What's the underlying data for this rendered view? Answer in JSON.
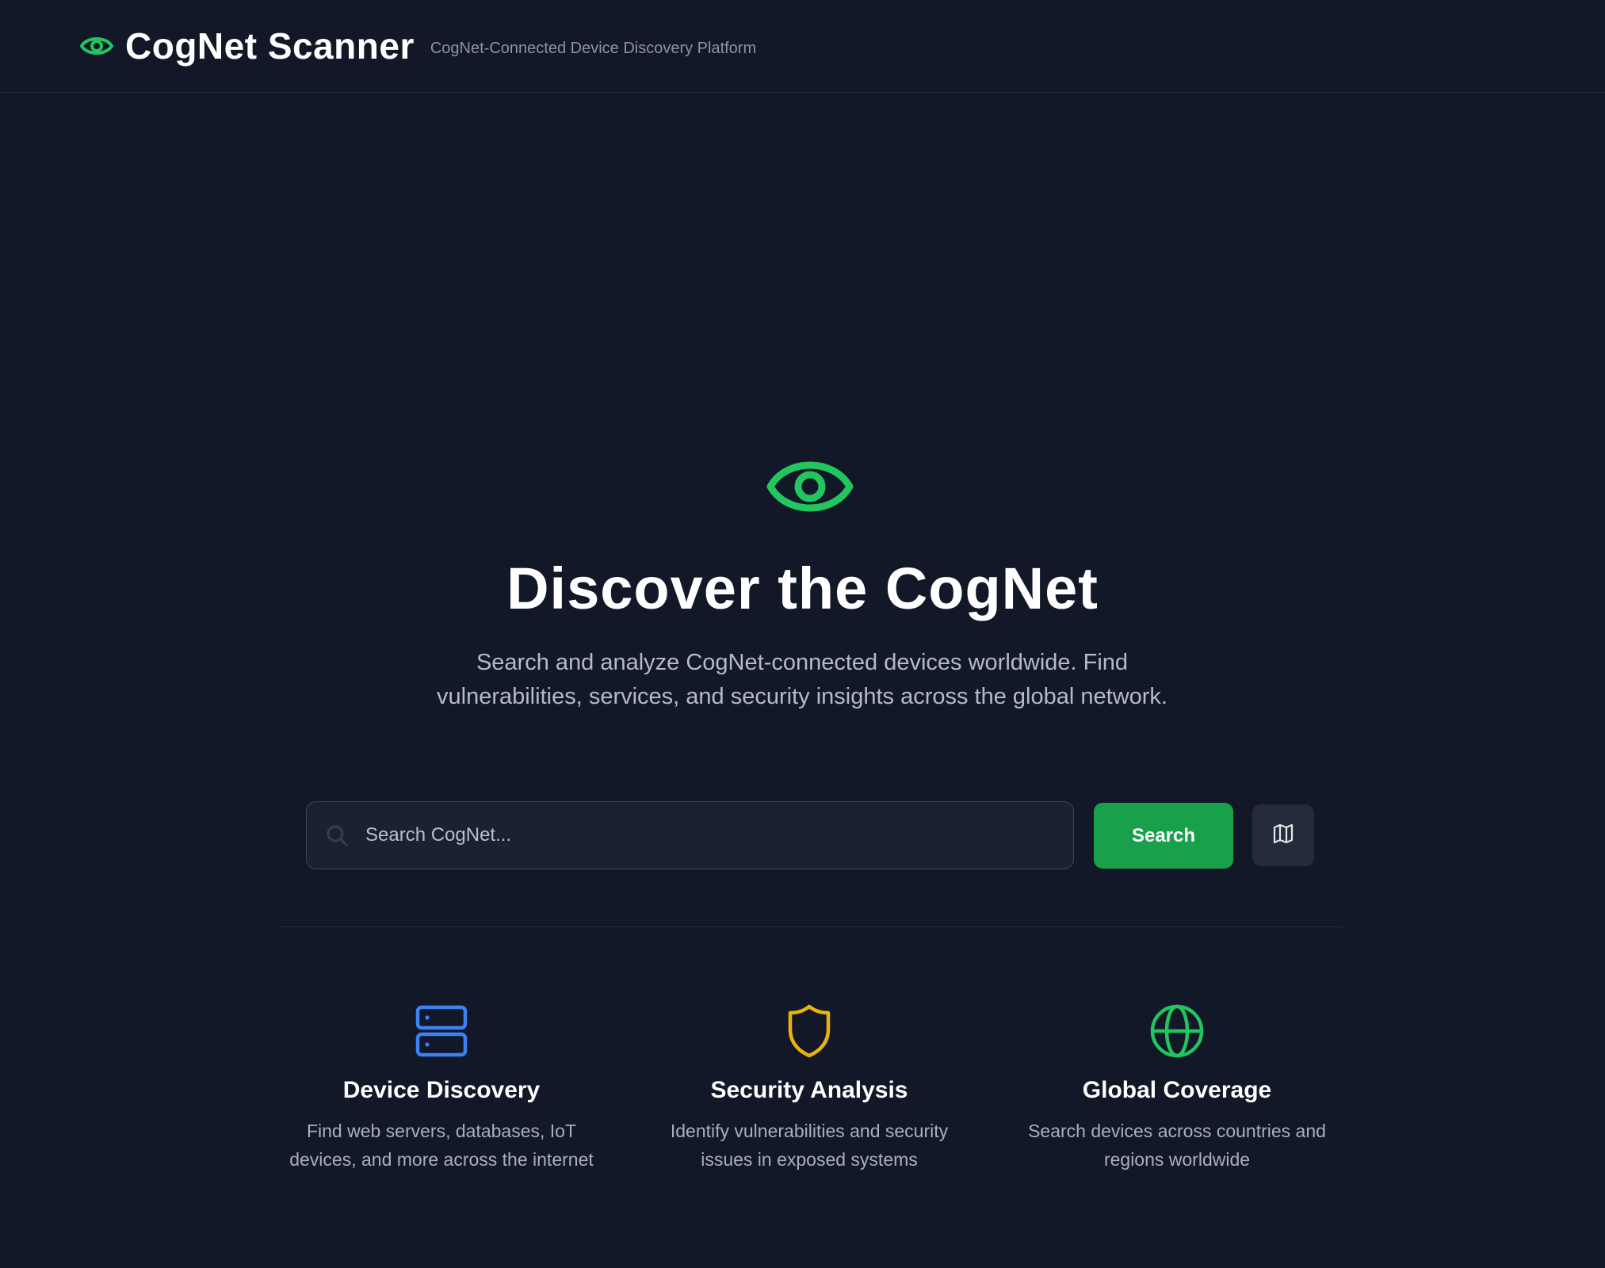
{
  "header": {
    "brand_icon": "eye-icon",
    "title": "CogNet Scanner",
    "subtitle": "CogNet-Connected Device Discovery Platform"
  },
  "hero": {
    "icon": "eye-icon",
    "title": "Discover the CogNet",
    "description": "Search and analyze CogNet-connected devices worldwide. Find vulnerabilities, services, and security insights across the global network."
  },
  "search": {
    "placeholder": "Search CogNet...",
    "value": "",
    "button_label": "Search",
    "map_icon": "map-icon"
  },
  "features": [
    {
      "icon": "server-icon",
      "title": "Device Discovery",
      "description": "Find web servers, databases, IoT devices, and more across the internet"
    },
    {
      "icon": "shield-icon",
      "title": "Security Analysis",
      "description": "Identify vulnerabilities and security issues in exposed systems"
    },
    {
      "icon": "globe-icon",
      "title": "Global Coverage",
      "description": "Search devices across countries and regions worldwide"
    }
  ],
  "colors": {
    "background": "#121828",
    "accent_green": "#22c55e",
    "button_green": "#19a04b",
    "server_blue": "#3b82f6",
    "shield_yellow": "#eab308"
  }
}
